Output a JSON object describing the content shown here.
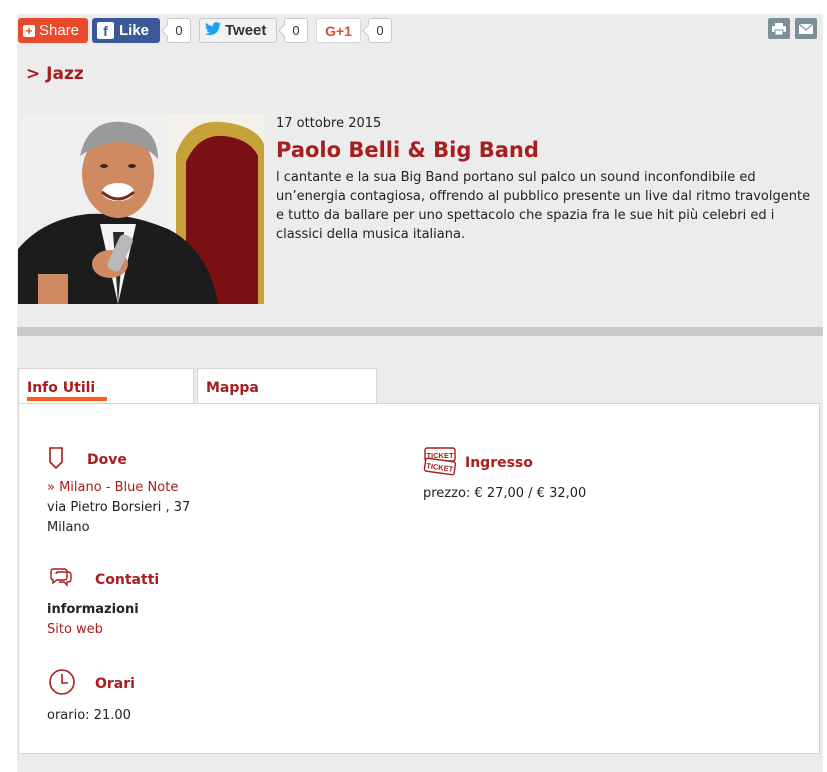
{
  "social": {
    "share_label": "Share",
    "like_label": "Like",
    "like_count": "0",
    "tweet_label": "Tweet",
    "tweet_count": "0",
    "gplus_label": "G+1",
    "gplus_count": "0"
  },
  "breadcrumb": "> Jazz",
  "event": {
    "date": "17 ottobre 2015",
    "title": "Paolo Belli & Big Band",
    "description": "l cantante e la sua Big Band portano sul palco un sound inconfondibile ed un’energia contagiosa, offrendo al pubblico presente un live dal ritmo travolgente e tutto da ballare per uno spettacolo che spazia fra le sue hit più celebri ed i classici della musica italiana."
  },
  "tabs": [
    "Info Utili",
    "Mappa"
  ],
  "info": {
    "dove": {
      "heading": "Dove",
      "venue_link": "» Milano - Blue Note",
      "address": "via Pietro Borsieri , 37",
      "city": "Milano"
    },
    "contatti": {
      "heading": "Contatti",
      "label": "informazioni",
      "link": "Sito web"
    },
    "orari": {
      "heading": "Orari",
      "value": "orario: 21.00"
    },
    "ingresso": {
      "heading": "Ingresso",
      "price": "prezzo: € 27,00 / € 32,00",
      "ticket_icon_text": "TICKET"
    }
  },
  "colors": {
    "accent_red": "#a81d1d",
    "tab_underline": "#ff5a1e",
    "share": "#ea4a2c",
    "facebook": "#3b5998",
    "twitter": "#1da1f2"
  }
}
